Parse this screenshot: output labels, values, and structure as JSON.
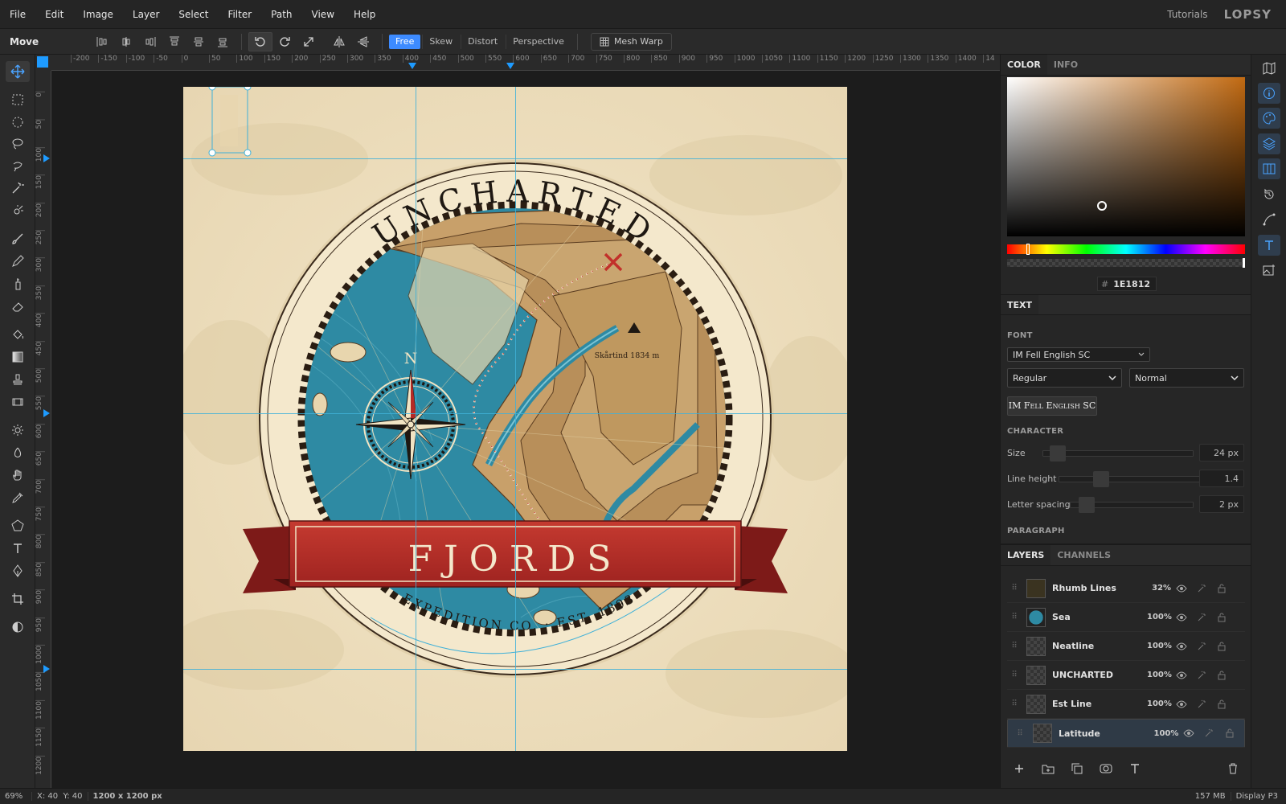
{
  "menu": {
    "items": [
      "File",
      "Edit",
      "Image",
      "Layer",
      "Select",
      "Filter",
      "Path",
      "View",
      "Help"
    ],
    "tutorials": "Tutorials",
    "logo": "LOPSY"
  },
  "options": {
    "tool_name": "Move",
    "modes": [
      "Free",
      "Skew",
      "Distort",
      "Perspective"
    ],
    "active_mode": "Free",
    "mesh_warp": "Mesh Warp"
  },
  "rulers": {
    "h": [
      "-200",
      "-150",
      "-100",
      "-50",
      "0",
      "50",
      "100",
      "150",
      "200",
      "250",
      "300",
      "350",
      "400",
      "450",
      "500",
      "550",
      "600",
      "650",
      "700",
      "750",
      "800",
      "850",
      "900",
      "950",
      "1000",
      "1050",
      "1100",
      "1150",
      "1200",
      "1250",
      "1300",
      "1350",
      "1400",
      "14"
    ],
    "v": [
      "0",
      "50",
      "100",
      "150",
      "200",
      "250",
      "300",
      "350",
      "400",
      "450",
      "500",
      "550",
      "600",
      "650",
      "700",
      "750",
      "800",
      "850",
      "900",
      "950",
      "1000",
      "1050",
      "1100",
      "1150",
      "1200"
    ]
  },
  "artwork": {
    "top_text": "UNCHARTED",
    "banner_text": "FJORDS",
    "bottom_text": "EXPEDITION CO. · EST. 1893",
    "compass_n": "N",
    "peak_label": "Skårtind 1834 m"
  },
  "panel": {
    "color_tabs": [
      "COLOR",
      "INFO"
    ],
    "hex_prefix": "#",
    "hex": "1E1812",
    "text_tab": "TEXT",
    "font_label": "FONT",
    "font_family": "IM Fell English SC",
    "font_style": "Regular",
    "font_variant": "Normal",
    "font_preview": "IM Fell English SC",
    "character_label": "CHARACTER",
    "size_label": "Size",
    "size_value": "24 px",
    "lineheight_label": "Line height",
    "lineheight_value": "1.4",
    "letterspacing_label": "Letter spacing",
    "letterspacing_value": "2 px",
    "paragraph_label": "PARAGRAPH",
    "layer_tabs": [
      "LAYERS",
      "CHANNELS"
    ],
    "layers": [
      {
        "name": "Rhumb Lines",
        "opacity": "32%"
      },
      {
        "name": "Sea",
        "opacity": "100%"
      },
      {
        "name": "Neatline",
        "opacity": "100%"
      },
      {
        "name": "UNCHARTED",
        "opacity": "100%"
      },
      {
        "name": "Est Line",
        "opacity": "100%"
      },
      {
        "name": "Latitude",
        "opacity": "100%"
      }
    ]
  },
  "status": {
    "zoom": "69%",
    "coords": "X: 40  Y: 40",
    "size": "1200 x 1200 px",
    "memory": "157 MB",
    "profile": "Display P3"
  },
  "colors": {
    "accent": "#3d8bff",
    "guide": "#3fb0d8",
    "banner": "#b52a26",
    "sea": "#2e8aa3",
    "land": "#c9a26a"
  }
}
